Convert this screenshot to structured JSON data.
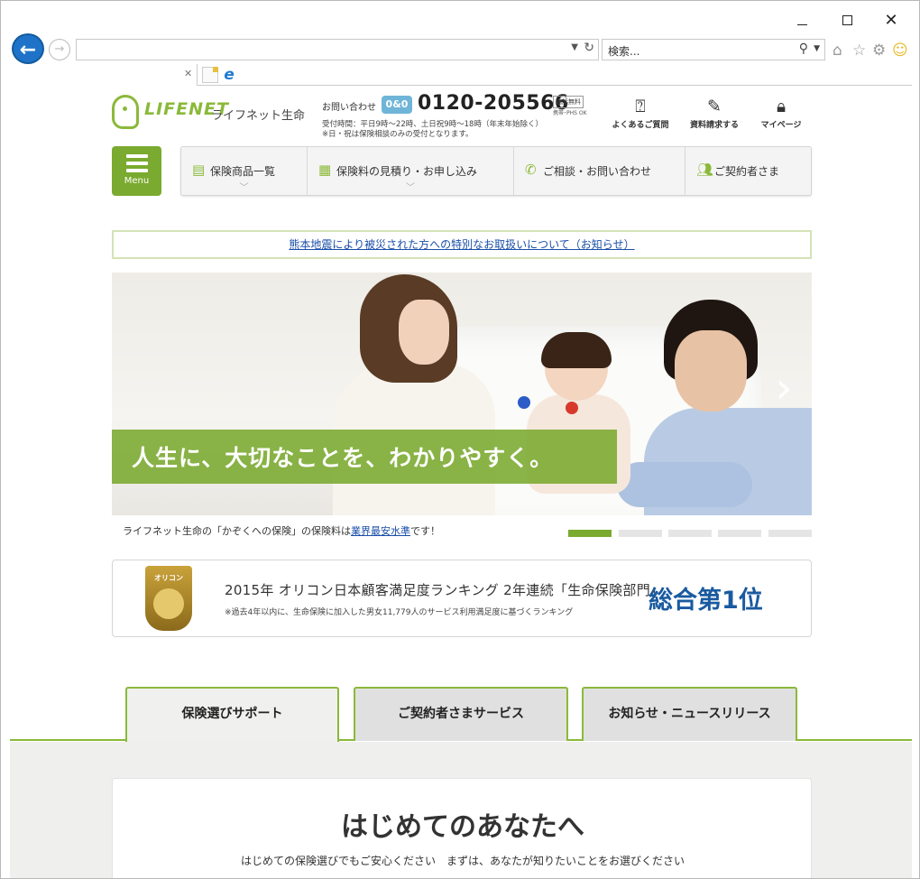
{
  "browser": {
    "window_controls": {
      "minimize": "—",
      "maximize": "□",
      "close": "✕"
    },
    "back_glyph": "←",
    "forward_glyph": "→",
    "address_value": "",
    "search_placeholder": "検索...",
    "toolbar_icons": [
      "home-icon",
      "favorites-star-icon",
      "settings-gear-icon",
      "smiley-feedback-icon"
    ]
  },
  "header": {
    "logo_word": "LIFENET",
    "logo_jp": "ライフネット生命",
    "contact_label": "お問い合わせ",
    "freedial_mark": "0&0",
    "phone": "0120-205566",
    "free_badge": "通話無料",
    "free_sub": "携帯･PHS OK",
    "hours_line1": "受付時間：平日9時〜22時、土日祝9時〜18時（年末年始除く）",
    "hours_line2": "※日・祝は保険相談のみの受付となります。",
    "links": [
      {
        "label": "よくあるご質問",
        "icon": "question-bubble-icon"
      },
      {
        "label": "資料請求する",
        "icon": "document-request-icon"
      },
      {
        "label": "マイページ",
        "icon": "lock-icon"
      }
    ]
  },
  "nav": {
    "menu_label": "Menu",
    "items": [
      {
        "label": "保険商品一覧",
        "icon": "clipboard-icon",
        "has_dropdown": true
      },
      {
        "label": "保険料の見積り・お申し込み",
        "icon": "calculator-icon",
        "has_dropdown": true
      },
      {
        "label": "ご相談・お問い合わせ",
        "icon": "phone-icon",
        "has_dropdown": false
      },
      {
        "label": "ご契約者さま",
        "icon": "people-icon",
        "has_dropdown": false
      }
    ]
  },
  "notice": {
    "text": "熊本地震により被災された方への特別なお取扱いについて（お知らせ）"
  },
  "hero": {
    "copy": "人生に、大切なことを、わかりやすく。",
    "next_glyph": "›",
    "caption_before": "ライフネット生命の「かぞくへの保険」の保険料は",
    "caption_link": "業界最安水準",
    "caption_after": "です！",
    "slide_count": 5,
    "active_slide": 1
  },
  "award": {
    "medal_text": "オリコン",
    "main": "2015年 オリコン日本顧客満足度ランキング 2年連続「生命保険部門」",
    "sub": "※過去4年以内に、生命保険に加入した男女11,779人のサービス利用満足度に基づくランキング",
    "rank": "総合第1位"
  },
  "tabs": [
    {
      "label": "保険選びサポート",
      "active": true
    },
    {
      "label": "ご契約者さまサービス",
      "active": false
    },
    {
      "label": "お知らせ・ニュースリリース",
      "active": false
    }
  ],
  "panel": {
    "title": "はじめてのあなたへ",
    "subtitle": "はじめての保険選びでもご安心ください　まずは、あなたが知りたいことをお選びください"
  },
  "colors": {
    "brand_green": "#7aaa2f",
    "link_blue": "#1a4ea8",
    "rank_blue": "#1a5aa0",
    "ie_blue": "#1e73c8"
  }
}
